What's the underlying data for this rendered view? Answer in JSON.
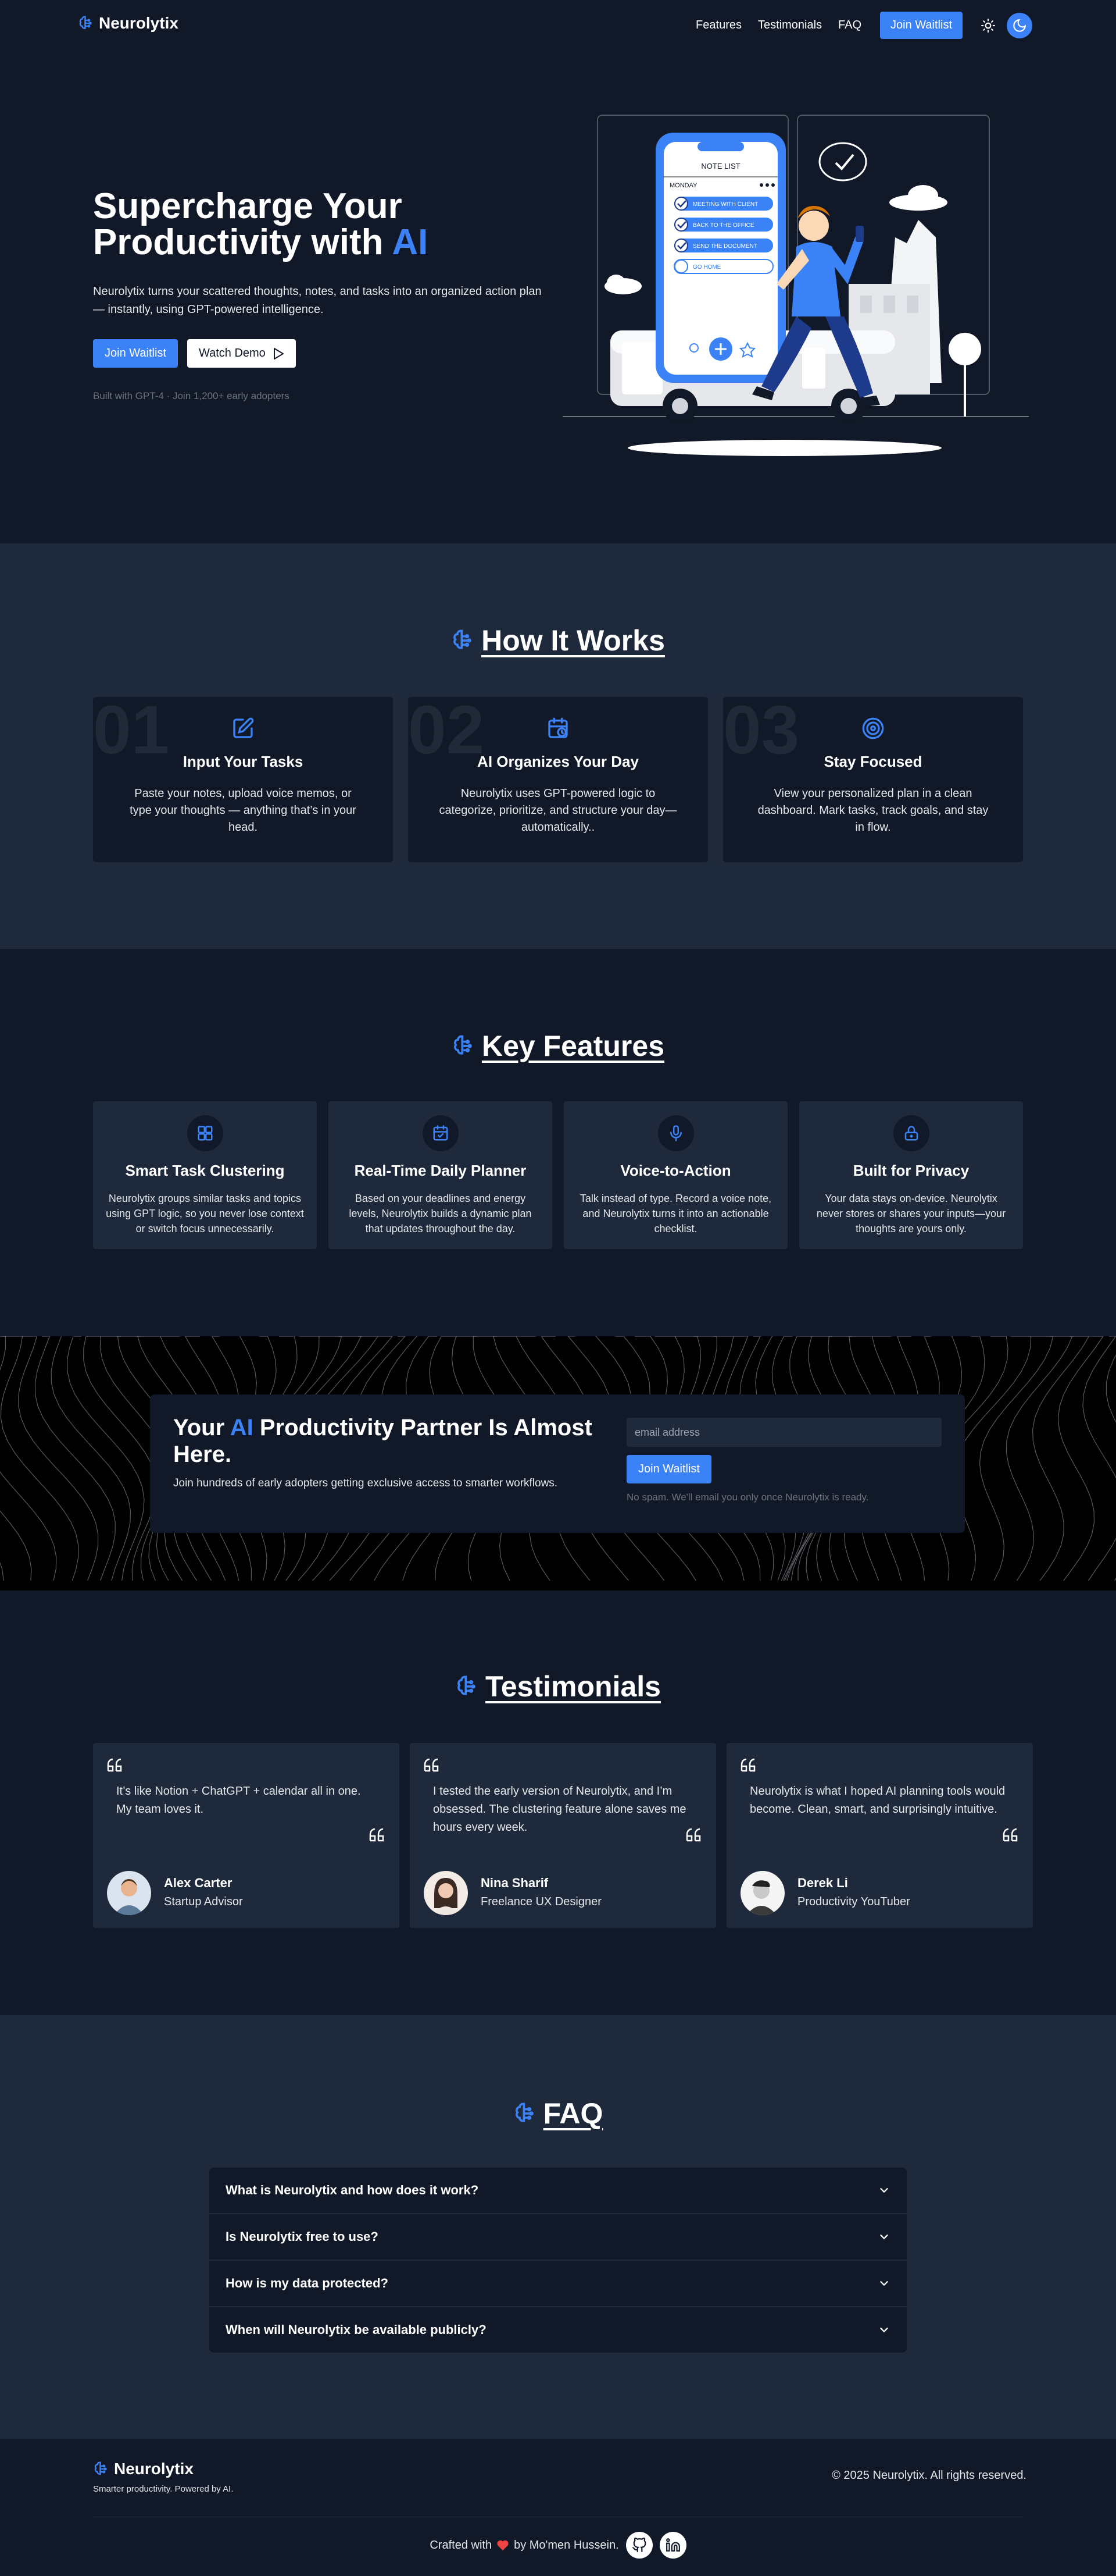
{
  "nav": {
    "brand": "Neurolytix",
    "links": [
      "Features",
      "Testimonials",
      "FAQ"
    ],
    "join_label": "Join Waitlist",
    "light_icon": "sun-icon",
    "dark_icon": "moon-icon"
  },
  "hero": {
    "title_line1": "Supercharge Your",
    "title_line2": "Productivity with ",
    "title_accent": "AI",
    "subtitle": "Neurolytix turns your scattered thoughts, notes, and tasks into an organized action plan — instantly, using GPT-powered intelligence.",
    "join_label": "Join Waitlist",
    "demo_label": "Watch Demo",
    "meta": "Built with GPT-4 · Join 1,200+ early adopters",
    "phone": {
      "header": "NOTE LIST",
      "day": "MONDAY",
      "tasks": [
        "MEETING WITH CLIENT",
        "BACK TO THE OFFICE",
        "SEND THE DOCUMENT",
        "GO HOME"
      ]
    }
  },
  "how": {
    "title": "How It Works",
    "steps": [
      {
        "num": "01",
        "title": "Input Your Tasks",
        "desc": "Paste your notes, upload voice memos, or type your thoughts — anything that’s in your head.",
        "icon": "edit-icon"
      },
      {
        "num": "02",
        "title": "AI Organizes Your Day",
        "desc": "Neurolytix uses GPT-powered logic to categorize, prioritize, and structure your day—automatically..",
        "icon": "calendar-clock-icon"
      },
      {
        "num": "03",
        "title": "Stay Focused",
        "desc": "View your personalized plan in a clean dashboard. Mark tasks, track goals, and stay in flow.",
        "icon": "target-icon"
      }
    ]
  },
  "features": {
    "title": "Key Features",
    "items": [
      {
        "title": "Smart Task Clustering",
        "desc": "Neurolytix groups similar tasks and topics using GPT logic, so you never lose context or switch focus unnecessarily.",
        "icon": "layout-icon"
      },
      {
        "title": "Real-Time Daily Planner",
        "desc": "Based on your deadlines and energy levels, Neurolytix builds a dynamic plan that updates throughout the day.",
        "icon": "calendar-icon"
      },
      {
        "title": "Voice-to-Action",
        "desc": "Talk instead of type. Record a voice note, and Neurolytix turns it into an actionable checklist.",
        "icon": "microphone-icon"
      },
      {
        "title": "Built for Privacy",
        "desc": "Your data stays on-device. Neurolytix never stores or shares your inputs—your thoughts are yours only.",
        "icon": "lock-icon"
      }
    ]
  },
  "cta": {
    "title_pre": "Your ",
    "title_accent": "AI",
    "title_post": " Productivity Partner Is Almost Here.",
    "subtitle": "Join hundreds of early adopters getting exclusive access to smarter workflows.",
    "email_placeholder": "email address",
    "join_label": "Join Waitlist",
    "note": "No spam. We'll email you only once Neurolytix is ready."
  },
  "testimonials": {
    "title": "Testimonials",
    "items": [
      {
        "quote": "It’s like Notion + ChatGPT + calendar all in one. My team loves it.",
        "name": "Alex Carter",
        "role": "Startup Advisor"
      },
      {
        "quote": "I tested the early version of Neurolytix, and I’m obsessed. The clustering feature alone saves me hours every week.",
        "name": "Nina Sharif",
        "role": "Freelance UX Designer"
      },
      {
        "quote": "Neurolytix is what I hoped AI planning tools would become. Clean, smart, and surprisingly intuitive.",
        "name": "Derek Li",
        "role": "Productivity YouTuber"
      }
    ]
  },
  "faq": {
    "title": "FAQ",
    "items": [
      "What is Neurolytix and how does it work?",
      "Is Neurolytix free to use?",
      "How is my data protected?",
      "When will Neurolytix be available publicly?"
    ]
  },
  "footer": {
    "brand": "Neurolytix",
    "tagline": "Smarter productivity. Powered by AI.",
    "copyright": "© 2025 Neurolytix. All rights reserved.",
    "crafted_pre": "Crafted with",
    "crafted_post": "by Mo'men Hussein.",
    "heart_icon": "heart-icon",
    "social_icons": [
      "github-icon",
      "linkedin-icon"
    ]
  },
  "colors": {
    "accent": "#3b82f6",
    "bg_dark": "#111827",
    "bg_panel": "#1e293b"
  }
}
